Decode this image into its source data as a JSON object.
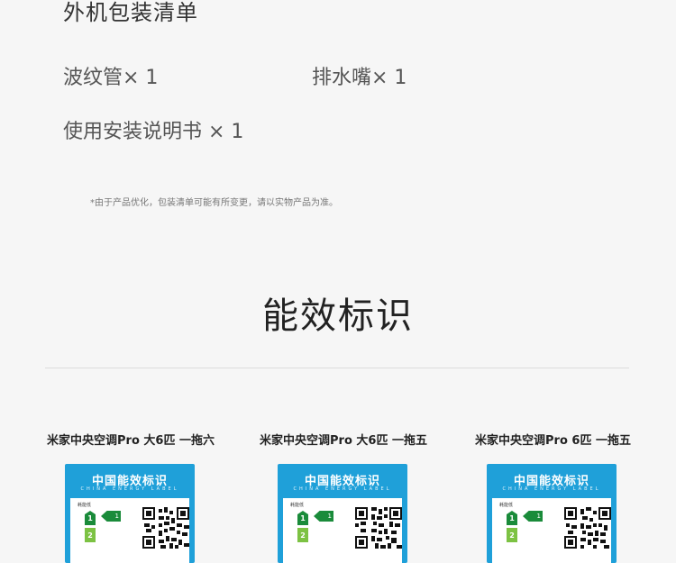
{
  "packing": {
    "title": "外机包装清单",
    "items": [
      "波纹管× 1",
      "排水嘴× 1",
      "使用安装说明书 × 1"
    ],
    "note": "*由于产品优化，包装清单可能有所变更，请以实物产品为准。"
  },
  "energy": {
    "title": "能效标识",
    "cards": [
      {
        "model": "米家中央空调Pro 大6匹 一拖六",
        "label_title": "中国能效标识",
        "label_sub": "CHINA ENERGY LABEL",
        "grade_text": "耗能低",
        "grade": "1"
      },
      {
        "model": "米家中央空调Pro 大6匹 一拖五",
        "label_title": "中国能效标识",
        "label_sub": "CHINA ENERGY LABEL",
        "grade_text": "耗能低",
        "grade": "1"
      },
      {
        "model": "米家中央空调Pro 6匹 一拖五",
        "label_title": "中国能效标识",
        "label_sub": "CHINA ENERGY LABEL",
        "grade_text": "耗能低",
        "grade": "1"
      }
    ]
  },
  "colors": {
    "label_blue": "#1fa0d9",
    "grade1_green": "#1a8b3a",
    "grade2_green": "#7cc243"
  }
}
